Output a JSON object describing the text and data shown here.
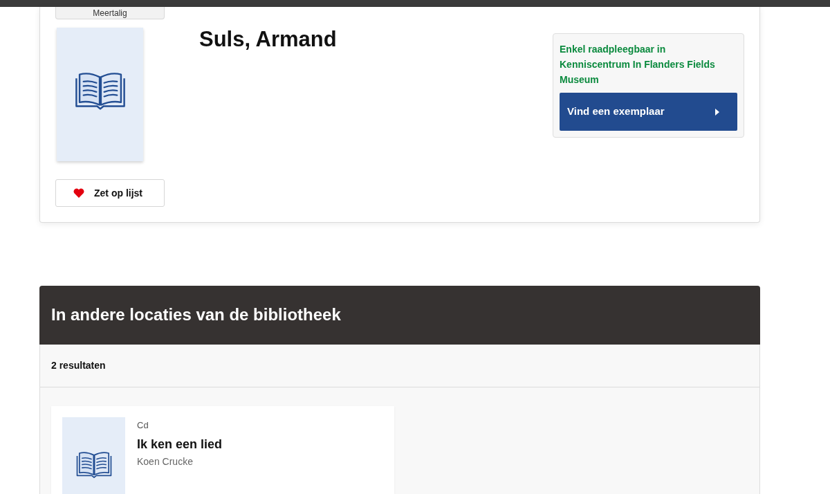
{
  "record": {
    "language_button": "Meertalig",
    "save_button": "Zet op lijst",
    "title": "Suls, Armand",
    "availability": {
      "message": "Enkel raadpleegbaar in Kenniscentrum In Flanders Fields Museum",
      "button": "Vind een exemplaar"
    }
  },
  "other_locations": {
    "title": "In andere locaties van de bibliotheek",
    "count": "2 resultaten",
    "results": [
      {
        "type": "Cd",
        "title": "Ik ken een lied",
        "author": "Koen Crucke"
      }
    ]
  }
}
